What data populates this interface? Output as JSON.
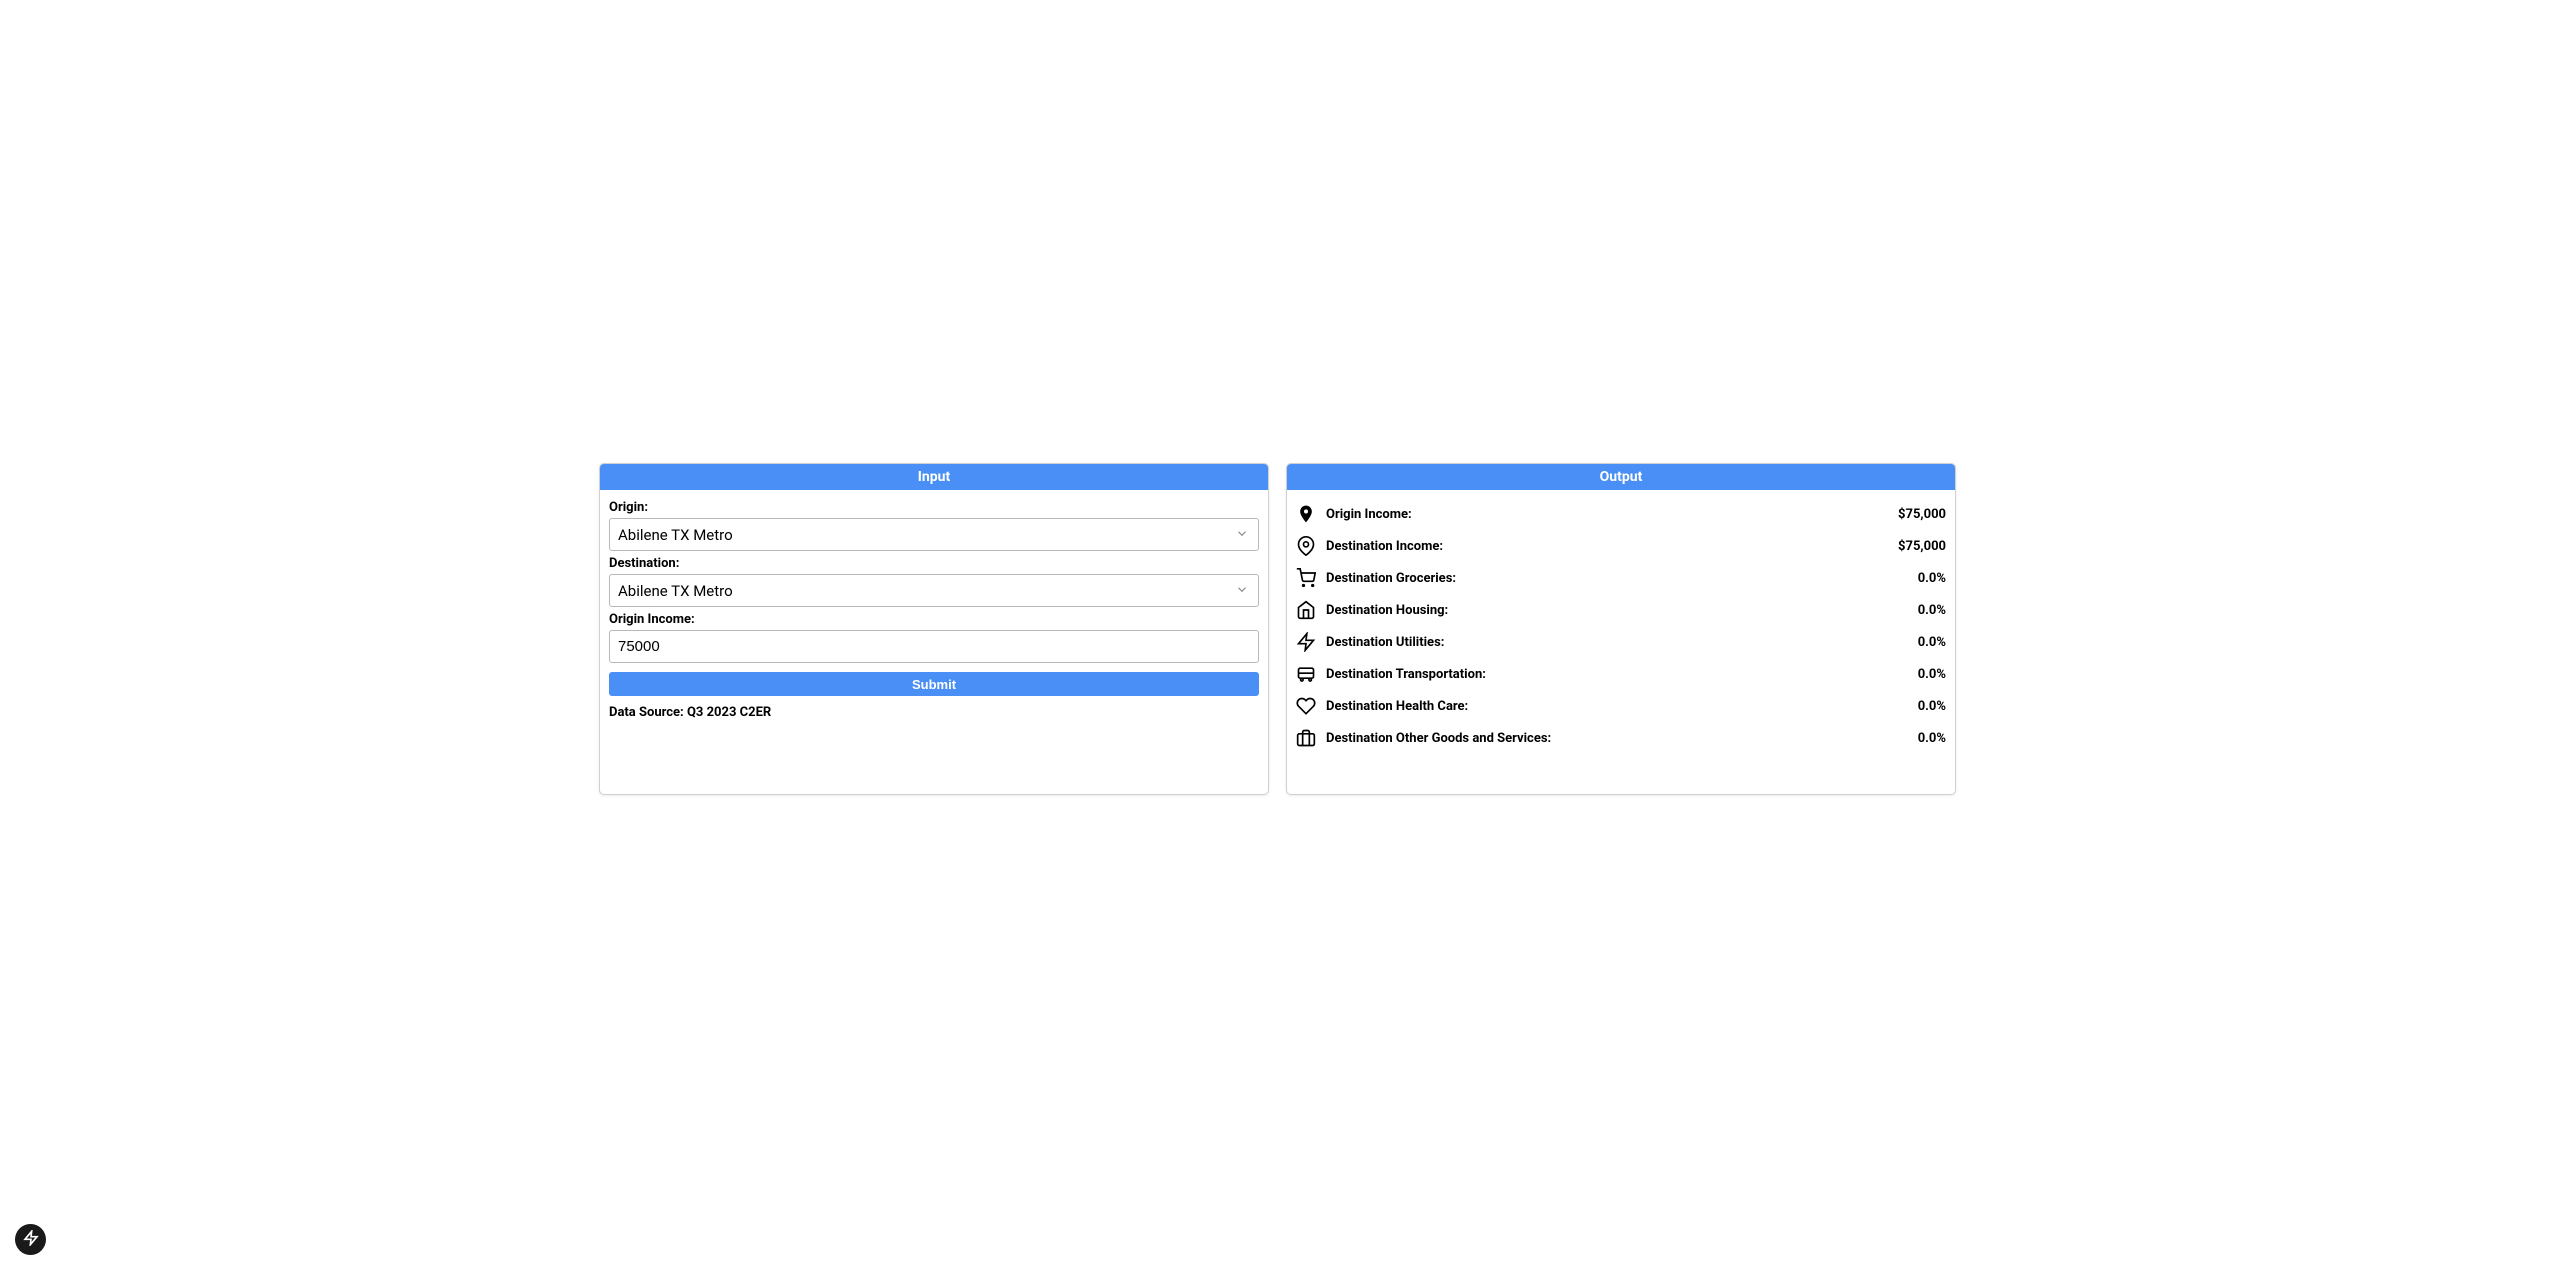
{
  "input": {
    "header": "Input",
    "origin_label": "Origin:",
    "origin_value": "Abilene TX Metro",
    "destination_label": "Destination:",
    "destination_value": "Abilene TX Metro",
    "income_label": "Origin Income:",
    "income_value": "75000",
    "submit_label": "Submit",
    "data_source": "Data Source: Q3 2023 C2ER"
  },
  "output": {
    "header": "Output",
    "rows": [
      {
        "label": "Origin Income:",
        "value": "$75,000"
      },
      {
        "label": "Destination Income:",
        "value": "$75,000"
      },
      {
        "label": "Destination Groceries:",
        "value": "0.0%"
      },
      {
        "label": "Destination Housing:",
        "value": "0.0%"
      },
      {
        "label": "Destination Utilities:",
        "value": "0.0%"
      },
      {
        "label": "Destination Transportation:",
        "value": "0.0%"
      },
      {
        "label": "Destination Health Care:",
        "value": "0.0%"
      },
      {
        "label": "Destination Other Goods and Services:",
        "value": "0.0%"
      }
    ]
  }
}
